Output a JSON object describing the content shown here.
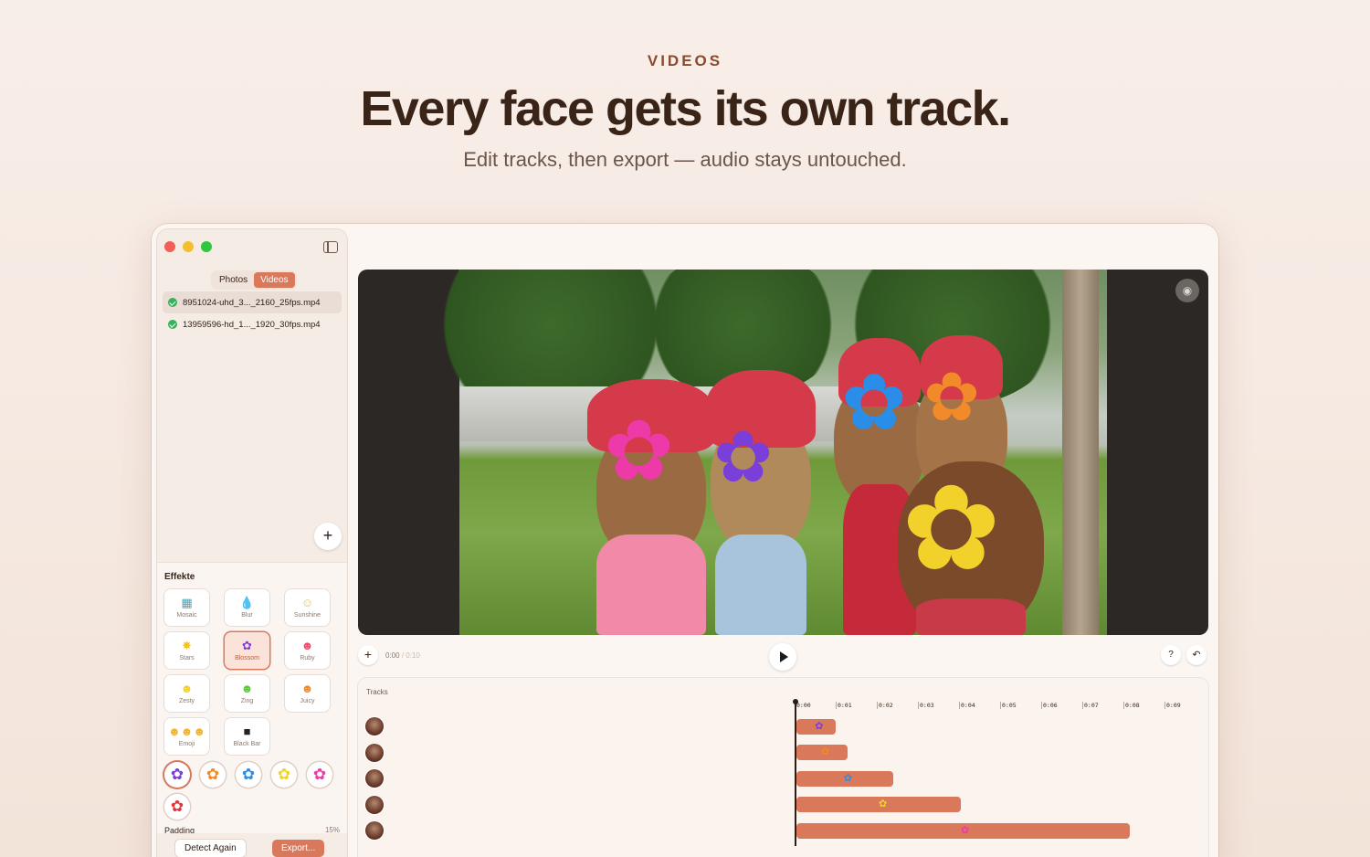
{
  "hero": {
    "eyebrow": "VIDEOS",
    "headline": "Every face gets its own track.",
    "subhead": "Edit tracks, then export — audio stays untouched."
  },
  "sidebar": {
    "segments": [
      "Photos",
      "Videos"
    ],
    "active_segment": "Videos",
    "files": [
      {
        "name": "8951024-uhd_3..._2160_25fps.mp4",
        "selected": true
      },
      {
        "name": "13959596-hd_1..._1920_30fps.mp4",
        "selected": false
      }
    ],
    "add_label": "+",
    "effects_title": "Effekte",
    "effects": [
      {
        "label": "Mosaic",
        "icon": "mosaic-icon"
      },
      {
        "label": "Blur",
        "icon": "droplet-icon"
      },
      {
        "label": "Sunshine",
        "icon": "sun-face-icon"
      },
      {
        "label": "Stars",
        "icon": "star-icon"
      },
      {
        "label": "Blossom",
        "icon": "flower-icon",
        "active": true
      },
      {
        "label": "Ruby",
        "icon": "ruby-face-icon"
      },
      {
        "label": "Zesty",
        "icon": "zesty-face-icon"
      },
      {
        "label": "Zing",
        "icon": "zing-face-icon"
      },
      {
        "label": "Juicy",
        "icon": "juicy-face-icon"
      },
      {
        "label": "Emoji",
        "icon": "emoji-icon"
      },
      {
        "label": "Black Bar",
        "icon": "black-bar-icon"
      }
    ],
    "swatch_colors": [
      "#7a3fd8",
      "#f28a2a",
      "#2a8de8",
      "#f2d22a",
      "#ee3aa8",
      "#e8323a"
    ],
    "padding_label": "Padding",
    "padding_value": "15%",
    "detect_label": "Detect Again",
    "export_label": "Export..."
  },
  "player": {
    "current_time": "0:00",
    "duration": "/ 0:10",
    "add_label": "+",
    "help_label": "?",
    "undo_label": "↶"
  },
  "tracks": {
    "title": "Tracks",
    "ticks": [
      "0:00",
      "0:01",
      "0:02",
      "0:03",
      "0:04",
      "0:05",
      "0:06",
      "0:07",
      "0:08",
      "0:09"
    ],
    "rows": [
      {
        "color": "#7a3fd8",
        "start_s": 0.0,
        "end_s": 0.95,
        "marker_s": 0.45
      },
      {
        "color": "#f28a2a",
        "start_s": 0.0,
        "end_s": 1.25,
        "marker_s": 0.6
      },
      {
        "color": "#2a8de8",
        "start_s": 0.0,
        "end_s": 2.35,
        "marker_s": 1.15
      },
      {
        "color": "#f2d22a",
        "start_s": 0.0,
        "end_s": 4.0,
        "marker_s": 2.0
      },
      {
        "color": "#ee3aa8",
        "start_s": 0.0,
        "end_s": 8.1,
        "marker_s": 4.0
      }
    ]
  },
  "colors": {
    "accent": "#d9785a",
    "success": "#34b35a"
  }
}
